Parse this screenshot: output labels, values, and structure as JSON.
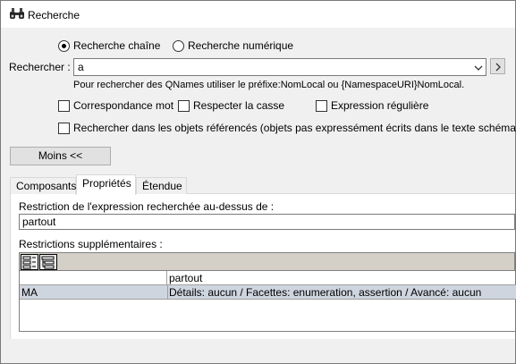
{
  "window": {
    "title": "Recherche"
  },
  "search_mode": {
    "string_label": "Recherche chaîne",
    "numeric_label": "Recherche numérique"
  },
  "search": {
    "label": "Rechercher :",
    "value": "a",
    "hint": "Pour rechercher des QNames utiliser le préfixe:NomLocal ou {NamespaceURI}NomLocal."
  },
  "options": {
    "word_match": "Correspondance mot",
    "match_case": "Respecter la casse",
    "regex": "Expression régulière",
    "referenced": "Rechercher dans les objets référencés (objets pas expressément écrits dans le texte schéma)"
  },
  "less_button": "Moins  <<",
  "tabs": [
    {
      "label": "Composants"
    },
    {
      "label": "Propriétés"
    },
    {
      "label": "Étendue"
    }
  ],
  "properties": {
    "restriction_label": "Restriction de l'expression recherchée au-dessus de :",
    "restriction_value": "partout",
    "additional_label": "Restrictions supplémentaires :",
    "grid_header_value": "partout",
    "rows": [
      {
        "name": "MA",
        "detail": "Détails: aucun / Facettes: enumeration, assertion / Avancé: aucun"
      }
    ]
  }
}
